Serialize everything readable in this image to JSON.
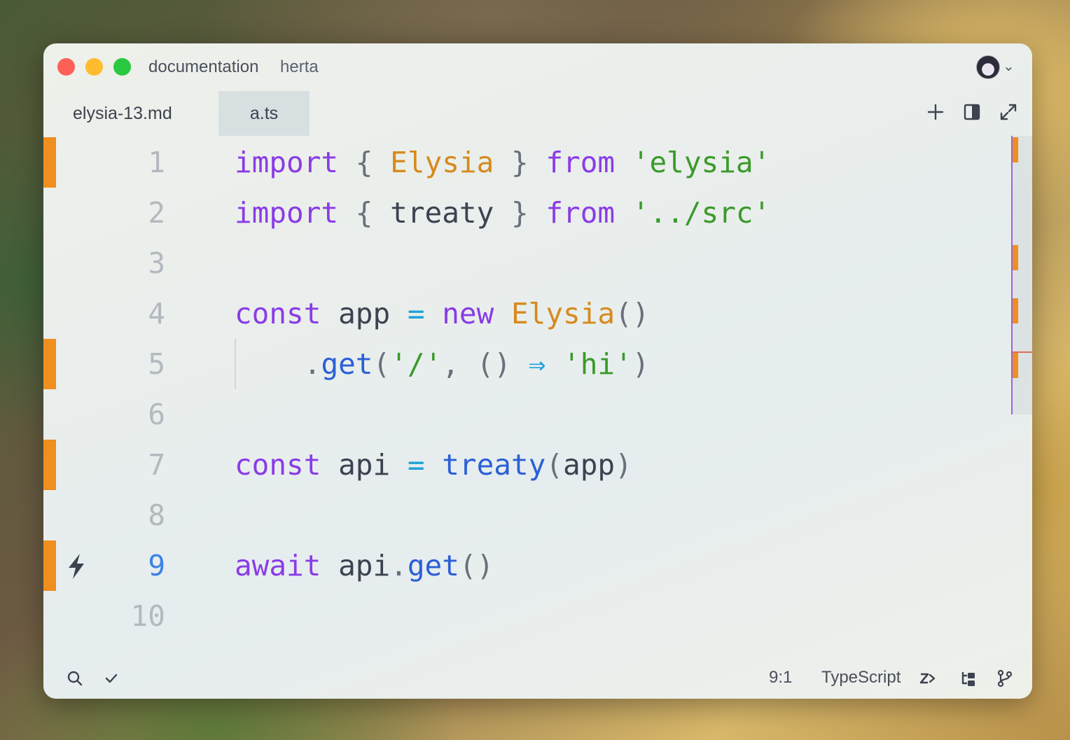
{
  "window": {
    "project": "documentation",
    "branch": "herta"
  },
  "tabs": [
    {
      "label": "elysia-13.md",
      "active": false
    },
    {
      "label": "a.ts",
      "active": true
    }
  ],
  "toolbar_icons": [
    "plus-icon",
    "split-pane-icon",
    "expand-icon"
  ],
  "editor": {
    "line_numbers": [
      "1",
      "2",
      "3",
      "4",
      "5",
      "6",
      "7",
      "8",
      "9",
      "10"
    ],
    "active_line": "9",
    "modified_lines": [
      1,
      5,
      7,
      9
    ],
    "lines": [
      [
        {
          "t": "kw",
          "v": "import"
        },
        {
          "t": "pn",
          "v": " { "
        },
        {
          "t": "cls",
          "v": "Elysia"
        },
        {
          "t": "pn",
          "v": " } "
        },
        {
          "t": "kw",
          "v": "from"
        },
        {
          "t": "pn",
          "v": " "
        },
        {
          "t": "str",
          "v": "'elysia'"
        }
      ],
      [
        {
          "t": "kw",
          "v": "import"
        },
        {
          "t": "pn",
          "v": " { "
        },
        {
          "t": "tx",
          "v": "treaty"
        },
        {
          "t": "pn",
          "v": " } "
        },
        {
          "t": "kw",
          "v": "from"
        },
        {
          "t": "pn",
          "v": " "
        },
        {
          "t": "str",
          "v": "'../src'"
        }
      ],
      [],
      [
        {
          "t": "kw",
          "v": "const"
        },
        {
          "t": "tx",
          "v": " app "
        },
        {
          "t": "op",
          "v": "="
        },
        {
          "t": "tx",
          "v": " "
        },
        {
          "t": "kw",
          "v": "new"
        },
        {
          "t": "tx",
          "v": " "
        },
        {
          "t": "cls",
          "v": "Elysia"
        },
        {
          "t": "pn",
          "v": "()"
        }
      ],
      [
        {
          "t": "tx",
          "v": "    "
        },
        {
          "t": "pn",
          "v": "."
        },
        {
          "t": "fn",
          "v": "get"
        },
        {
          "t": "pn",
          "v": "("
        },
        {
          "t": "str",
          "v": "'/'"
        },
        {
          "t": "pn",
          "v": ", () "
        },
        {
          "t": "op",
          "v": "⇒"
        },
        {
          "t": "tx",
          "v": " "
        },
        {
          "t": "str",
          "v": "'hi'"
        },
        {
          "t": "pn",
          "v": ")"
        }
      ],
      [],
      [
        {
          "t": "kw",
          "v": "const"
        },
        {
          "t": "tx",
          "v": " api "
        },
        {
          "t": "op",
          "v": "="
        },
        {
          "t": "tx",
          "v": " "
        },
        {
          "t": "fn",
          "v": "treaty"
        },
        {
          "t": "pn",
          "v": "("
        },
        {
          "t": "tx",
          "v": "app"
        },
        {
          "t": "pn",
          "v": ")"
        }
      ],
      [],
      [
        {
          "t": "kw",
          "v": "await"
        },
        {
          "t": "tx",
          "v": " api"
        },
        {
          "t": "pn",
          "v": "."
        },
        {
          "t": "fn",
          "v": "get"
        },
        {
          "t": "pn",
          "v": "()"
        }
      ],
      []
    ],
    "gutter_icon": "lightning-bolt-icon"
  },
  "statusbar": {
    "cursor": "9:1",
    "language": "TypeScript",
    "icons": [
      "search-icon",
      "checkmark-icon",
      "zed-ai-icon",
      "outline-icon",
      "git-branch-icon"
    ]
  },
  "colors": {
    "keyword": "#8a3ce6",
    "class": "#d68a1d",
    "string": "#3b9a2a",
    "function": "#2b5fd8",
    "operator": "#1fa2d8",
    "modified": "#ee8f1f",
    "active_line_number": "#3b82e8"
  }
}
